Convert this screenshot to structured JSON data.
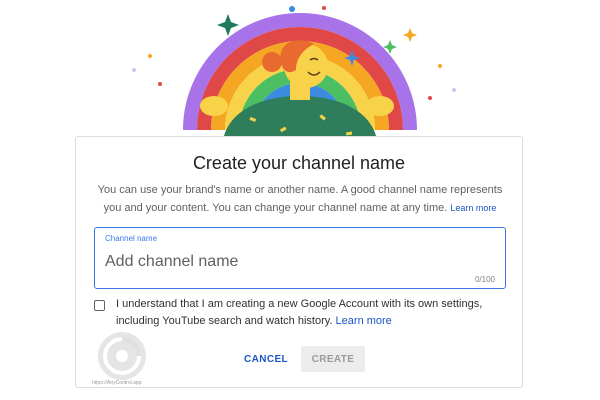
{
  "dialog": {
    "title": "Create your channel name",
    "description": "You can use your brand's name or another name. A good channel name represents you and your content. You can change your channel name at any time.",
    "learn_more_label": "Learn more",
    "channel_name": {
      "label": "Channel name",
      "value": "",
      "placeholder": "Add channel name",
      "counter": "0/100"
    },
    "consent": {
      "checked": false,
      "text": "I understand that I am creating a new Google Account with its own settings, including YouTube search and watch history.",
      "learn_more_label": "Learn more"
    },
    "buttons": {
      "cancel_label": "CANCEL",
      "create_label": "CREATE"
    }
  },
  "watermark": {
    "text": "https://AnyControl.app"
  },
  "colors": {
    "accent": "#1a56c5",
    "field_border": "#3a78e8",
    "disabled_bg": "#ececec",
    "disabled_text": "#9a9a9a"
  },
  "icons": {
    "hero": "rainbow-person-illustration",
    "checkbox": "checkbox-unchecked-icon",
    "watermark": "anycontrol-logo-icon"
  }
}
